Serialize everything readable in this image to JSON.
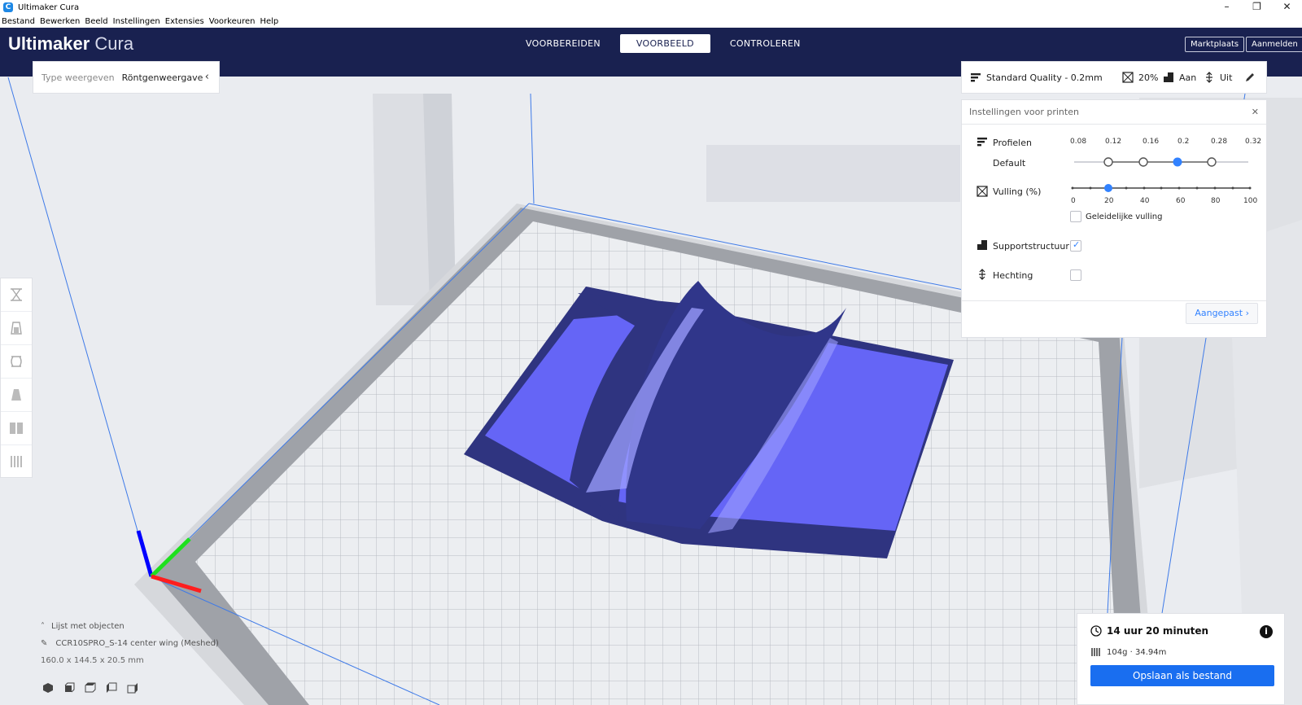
{
  "window": {
    "title": "Ultimaker Cura",
    "app_icon": "C",
    "controls": [
      "–",
      "❐",
      "✕"
    ]
  },
  "menu": [
    "Bestand",
    "Bewerken",
    "Beeld",
    "Instellingen",
    "Extensies",
    "Voorkeuren",
    "Help"
  ],
  "brand": {
    "name": "Ultimaker",
    "product": "Cura"
  },
  "stages": [
    {
      "label": "VOORBEREIDEN",
      "active": false
    },
    {
      "label": "VOORBEELD",
      "active": true
    },
    {
      "label": "CONTROLEREN",
      "active": false
    }
  ],
  "header_buttons": {
    "marketplace": "Marktplaats",
    "signin": "Aanmelden"
  },
  "view_type": {
    "label": "Type weergeven",
    "value": "Röntgenweergave"
  },
  "quality_bar": {
    "profile": "Standard Quality - 0.2mm",
    "infill": "20%",
    "support": "Aan",
    "adhesion": "Uit"
  },
  "print_settings": {
    "title": "Instellingen voor printen",
    "profiles_label": "Profielen",
    "profile_default": "Default",
    "layer_heights": [
      "0.08",
      "0.12",
      "0.16",
      "0.2",
      "0.28",
      "0.32"
    ],
    "selected_layer_height": "0.2",
    "infill_label": "Vulling (%)",
    "infill_ticks": [
      "0",
      "20",
      "40",
      "60",
      "80",
      "100"
    ],
    "infill_value": 20,
    "gradual_infill_label": "Geleidelijke vulling",
    "gradual_infill_checked": false,
    "support_label": "Supportstructuur",
    "support_checked": true,
    "adhesion_label": "Hechting",
    "adhesion_checked": false,
    "custom_button": "Aangepast"
  },
  "objects": {
    "toggle_label": "Lijst met objecten",
    "object_name": "CCR10SPRO_S-14 center wing (Meshed)",
    "dimensions": "160.0 x 144.5 x 20.5 mm"
  },
  "print_info": {
    "time": "14 uur 20 minuten",
    "material": "104g · 34.94m",
    "save_button": "Opslaan als bestand"
  },
  "colors": {
    "header": "#192150",
    "accent": "#3282ff",
    "model": "#5f5ff2",
    "model_dark": "#2f3480",
    "save": "#196ef0"
  }
}
